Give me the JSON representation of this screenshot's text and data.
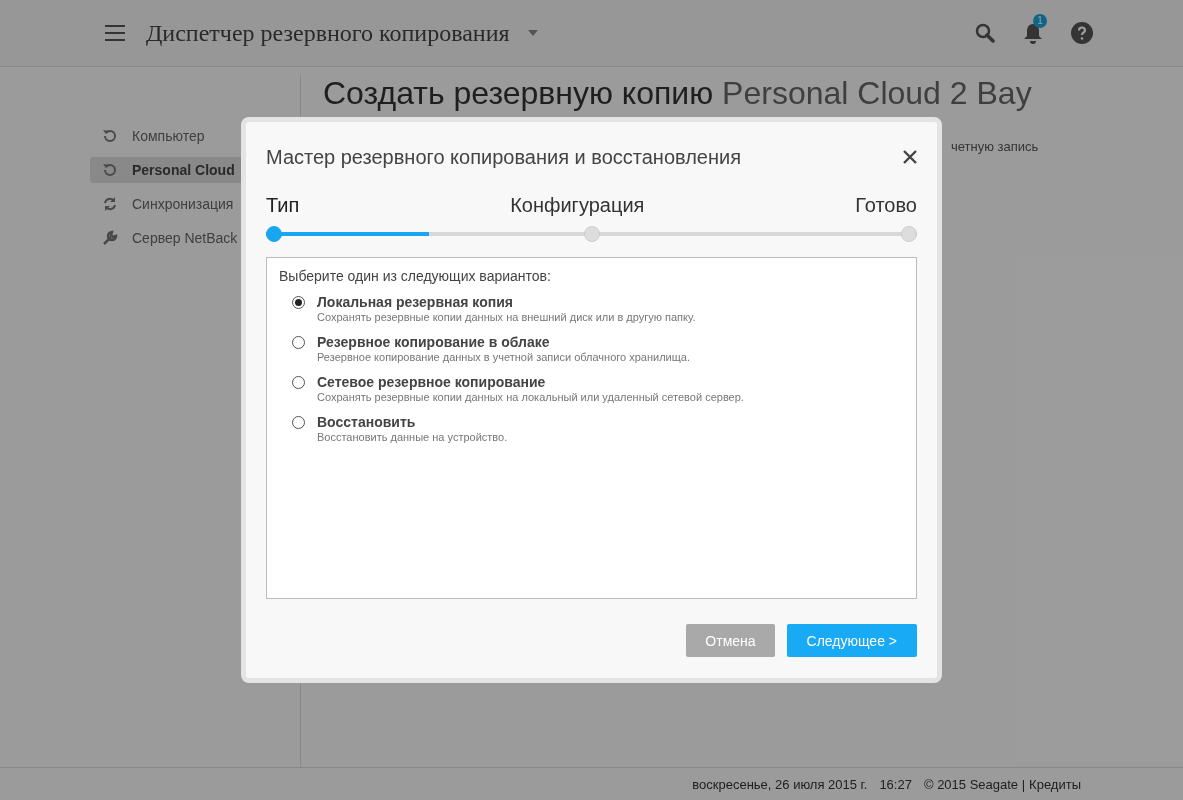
{
  "header": {
    "title": "Диспетчер резервного копирования",
    "notification_count": "1"
  },
  "sidebar": {
    "items": [
      {
        "label": "Компьютер",
        "kind": "history",
        "selected": false
      },
      {
        "label": "Personal Cloud",
        "kind": "history",
        "selected": true
      },
      {
        "label": "Синхронизация",
        "kind": "sync",
        "selected": false
      },
      {
        "label": "Сервер NetBack",
        "kind": "wrench",
        "selected": false
      }
    ]
  },
  "page": {
    "title_bold": "Создать резервную копию",
    "title_rest": "Personal Cloud 2 Bay",
    "subtitle": "четную запись"
  },
  "dialog": {
    "title": "Мастер резервного копирования и восстановления",
    "steps": [
      {
        "label": "Тип",
        "selected": true
      },
      {
        "label": "Конфигурация",
        "selected": false
      },
      {
        "label": "Готово",
        "selected": false
      }
    ],
    "progress": {
      "level": 0.25
    },
    "prompt": "Выберите один из следующих вариантов:",
    "options": [
      {
        "label": "Локальная резервная копия",
        "description": "Сохранять резервные копии данных на внешний диск или в другую папку.",
        "selected": true
      },
      {
        "label": "Резервное копирование в облаке",
        "description": "Резервное копирование данных в учетной записи облачного хранилища.",
        "selected": false
      },
      {
        "label": "Сетевое резервное копирование",
        "description": "Сохранять резервные копии данных на локальный или удаленный сетевой сервер.",
        "selected": false
      },
      {
        "label": "Восстановить",
        "description": "Восстановить данные на устройство.",
        "selected": false
      }
    ],
    "buttons": {
      "cancel": "Отмена",
      "next": "Следующее >"
    }
  },
  "footer": {
    "date": "воскресенье, 26 июля 2015 г.",
    "time": "16:27",
    "copyright": "© 2015 Seagate |",
    "link": "Кредиты"
  }
}
